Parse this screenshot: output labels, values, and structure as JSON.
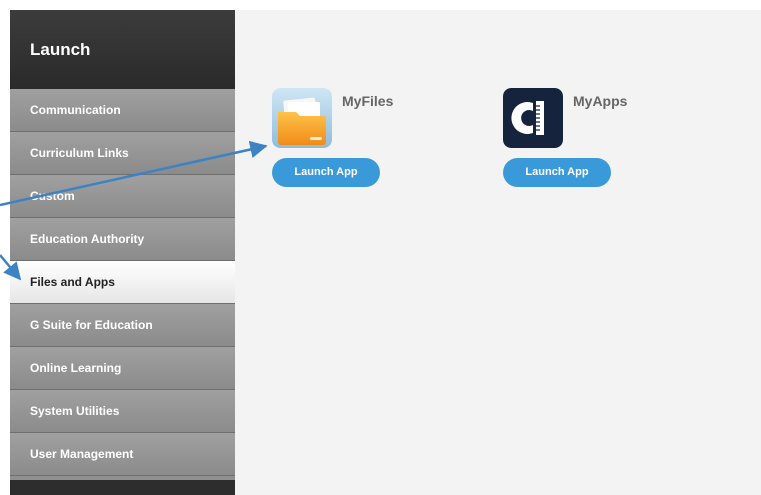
{
  "sidebar": {
    "title": "Launch",
    "items": [
      {
        "label": "Communication",
        "active": false
      },
      {
        "label": "Curriculum Links",
        "active": false
      },
      {
        "label": "Custom",
        "active": false
      },
      {
        "label": "Education Authority",
        "active": false
      },
      {
        "label": "Files and Apps",
        "active": true
      },
      {
        "label": "G Suite for Education",
        "active": false
      },
      {
        "label": "Online Learning",
        "active": false
      },
      {
        "label": "System Utilities",
        "active": false
      },
      {
        "label": "User Management",
        "active": false
      }
    ]
  },
  "apps": [
    {
      "name": "MyFiles",
      "icon": "folder-icon",
      "button_label": "Launch App"
    },
    {
      "name": "MyApps",
      "icon": "myapps-icon",
      "button_label": "Launch App"
    }
  ],
  "colors": {
    "accent": "#3a9ad9",
    "annotation": "#3d83c4"
  }
}
